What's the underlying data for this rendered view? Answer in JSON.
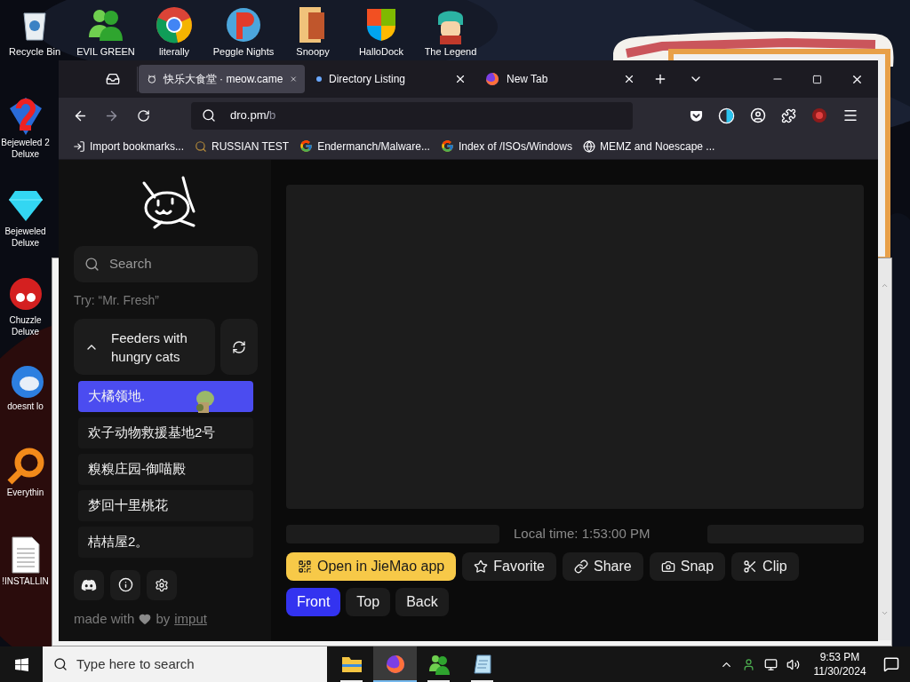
{
  "desktop": {
    "top_icons": [
      {
        "label": "Recycle Bin"
      },
      {
        "label": "EVIL GREEN"
      },
      {
        "label": "literally"
      },
      {
        "label": "Peggle Nights"
      },
      {
        "label": "Snoopy"
      },
      {
        "label": "HalloDock"
      },
      {
        "label": "The Legend"
      }
    ],
    "left_icons": [
      {
        "label": "Bejeweled 2",
        "label2": "Deluxe"
      },
      {
        "label": "Bejeweled",
        "label2": "Deluxe"
      },
      {
        "label": "Chuzzle",
        "label2": "Deluxe"
      },
      {
        "label": "doesnt lo"
      },
      {
        "label": "Everythin"
      },
      {
        "label": "!INSTALLIN"
      }
    ]
  },
  "browser": {
    "tabs": [
      {
        "title": "快乐大食堂 · meow.came",
        "selected": true
      },
      {
        "title": "Directory Listing",
        "selected": false
      },
      {
        "title": "New Tab",
        "selected": false
      }
    ],
    "address": {
      "host": "dro.pm/",
      "path": "b"
    },
    "bookmarks": [
      {
        "label": "Import bookmarks...",
        "kind": "import"
      },
      {
        "label": "RUSSIAN TEST",
        "kind": "search"
      },
      {
        "label": "Endermanch/Malware...",
        "kind": "google"
      },
      {
        "label": "Index of /ISOs/Windows",
        "kind": "google"
      },
      {
        "label": "MEMZ and Noescape ...",
        "kind": "globe"
      }
    ],
    "page": {
      "search": {
        "placeholder": "Search"
      },
      "hint": "Try: “Mr. Fresh”",
      "group": {
        "title": "Feeders with hungry cats",
        "expanded": true
      },
      "feeders": [
        {
          "name": "大橘领地.",
          "selected": true
        },
        {
          "name": "欢子动物救援基地2号",
          "selected": false
        },
        {
          "name": "糗糗庄园-御喵殿",
          "selected": false
        },
        {
          "name": "梦回十里桃花",
          "selected": false
        },
        {
          "name": "桔桔屋2。",
          "selected": false
        }
      ],
      "credit": {
        "before": "made with",
        "by": "by",
        "link": "imput"
      },
      "local_time": "Local time: 1:53:00 PM",
      "actions": [
        {
          "label": "Open in JieMao app",
          "kind": "qr",
          "primary": true
        },
        {
          "label": "Favorite",
          "kind": "star",
          "primary": false
        },
        {
          "label": "Share",
          "kind": "link",
          "primary": false
        },
        {
          "label": "Snap",
          "kind": "camera",
          "primary": false
        },
        {
          "label": "Clip",
          "kind": "scissors",
          "primary": false
        }
      ],
      "views": [
        {
          "label": "Front",
          "selected": true
        },
        {
          "label": "Top",
          "selected": false
        },
        {
          "label": "Back",
          "selected": false
        }
      ]
    }
  },
  "taskbar": {
    "search": {
      "placeholder": "Type here to search"
    },
    "apps": [
      {
        "kind": "folder",
        "active": false
      },
      {
        "kind": "firefox",
        "active": true
      },
      {
        "kind": "people",
        "active": false
      },
      {
        "kind": "notepad",
        "active": false
      }
    ],
    "clock": {
      "time": "9:53 PM",
      "date": "11/30/2024"
    }
  }
}
